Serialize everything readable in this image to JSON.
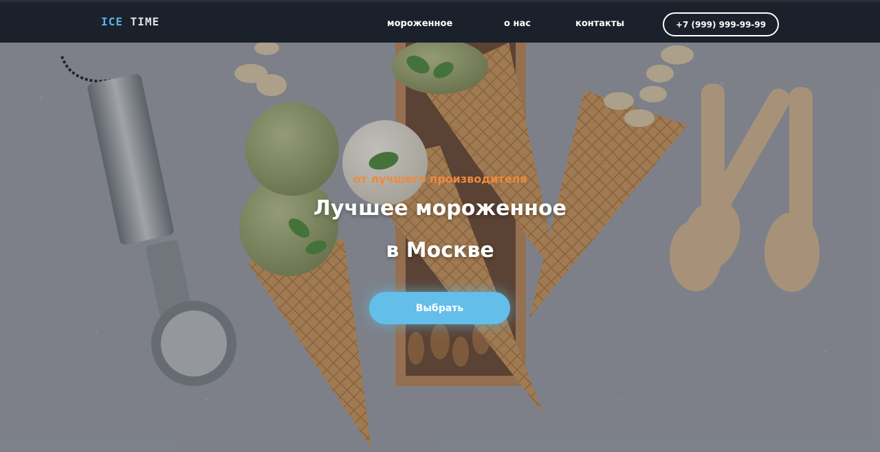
{
  "brand": {
    "part1": "ICE",
    "part2": "TIME"
  },
  "nav": [
    {
      "label": "мороженное"
    },
    {
      "label": "о нас"
    },
    {
      "label": "контакты"
    }
  ],
  "phone": "+7 (999) 999-99-99",
  "hero": {
    "tagline": "от лучшего производителя",
    "title_line1": "Лучшее мороженное",
    "title_line2": "в Москве",
    "cta": "Выбрать"
  },
  "colors": {
    "header_bg": "#1b212a",
    "accent_blue": "#63bfea",
    "accent_orange": "#ee8a3c",
    "logo_blue": "#5ab4e6"
  }
}
